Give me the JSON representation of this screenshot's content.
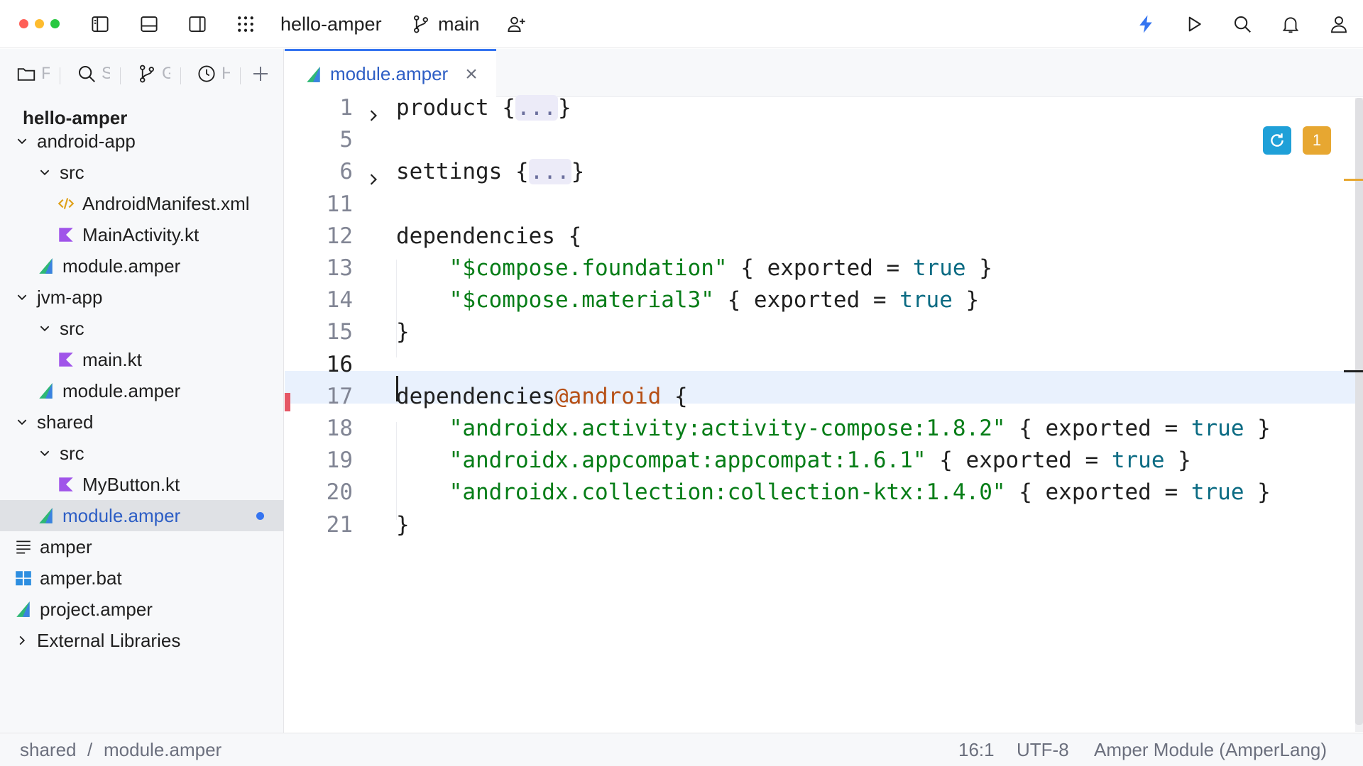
{
  "titlebar": {
    "project": "hello-amper",
    "branch": "main",
    "icons": [
      "sidebar-left-icon",
      "bottom-panel-icon",
      "sidebar-right-icon",
      "app-grid-icon",
      "branch-icon",
      "add-user-icon",
      "lightning-icon",
      "run-icon",
      "search-icon",
      "bell-icon",
      "profile-icon"
    ],
    "traffic_colors": [
      "#ff5f57",
      "#febc2e",
      "#28c840"
    ],
    "accent_color": "#3574f0"
  },
  "left_panel": {
    "tabs": [
      {
        "icon": "folder-icon",
        "label": "F"
      },
      {
        "icon": "search-icon",
        "label": "S"
      },
      {
        "icon": "git-icon",
        "label": "G"
      },
      {
        "icon": "clock-icon",
        "label": "H"
      }
    ],
    "root": "hello-amper",
    "items": [
      {
        "label": "android-app"
      },
      {
        "label": "src"
      },
      {
        "label": "AndroidManifest.xml"
      },
      {
        "label": "MainActivity.kt"
      },
      {
        "label": "module.amper"
      },
      {
        "label": "jvm-app"
      },
      {
        "label": "src"
      },
      {
        "label": "main.kt"
      },
      {
        "label": "module.amper"
      },
      {
        "label": "shared"
      },
      {
        "label": "src"
      },
      {
        "label": "MyButton.kt"
      },
      {
        "label": "module.amper"
      },
      {
        "label": "amper"
      },
      {
        "label": "amper.bat"
      },
      {
        "label": "project.amper"
      },
      {
        "label": "External Libraries"
      }
    ]
  },
  "editor": {
    "tab_label": "module.amper",
    "tab_close": "×",
    "warning_count": "1",
    "lines": [
      {
        "num": "1",
        "parts": [
          {
            "t": "product {"
          },
          {
            "t": "...",
            "c": "folded"
          },
          {
            "t": "}"
          }
        ]
      },
      {
        "num": "5",
        "parts": []
      },
      {
        "num": "6",
        "parts": [
          {
            "t": "settings {"
          },
          {
            "t": "...",
            "c": "folded"
          },
          {
            "t": "}"
          }
        ]
      },
      {
        "num": "11",
        "parts": []
      },
      {
        "num": "12",
        "parts": [
          {
            "t": "dependencies {"
          }
        ]
      },
      {
        "num": "13",
        "parts": [
          {
            "t": "    "
          },
          {
            "t": "\"$compose.foundation\"",
            "c": "str"
          },
          {
            "t": " { exported = "
          },
          {
            "t": "true",
            "c": "kw"
          },
          {
            "t": " }"
          }
        ]
      },
      {
        "num": "14",
        "parts": [
          {
            "t": "    "
          },
          {
            "t": "\"$compose.material3\"",
            "c": "str"
          },
          {
            "t": " { exported = "
          },
          {
            "t": "true",
            "c": "kw"
          },
          {
            "t": " }"
          }
        ]
      },
      {
        "num": "15",
        "parts": [
          {
            "t": "}"
          }
        ]
      },
      {
        "num": "16",
        "parts": []
      },
      {
        "num": "17",
        "parts": [
          {
            "t": "dependencies"
          },
          {
            "t": "@android",
            "c": "ann"
          },
          {
            "t": " {"
          }
        ]
      },
      {
        "num": "18",
        "parts": [
          {
            "t": "    "
          },
          {
            "t": "\"androidx.activity:activity-compose:1.8.2\"",
            "c": "str"
          },
          {
            "t": " { exported = "
          },
          {
            "t": "true",
            "c": "kw"
          },
          {
            "t": " }"
          }
        ]
      },
      {
        "num": "19",
        "parts": [
          {
            "t": "    "
          },
          {
            "t": "\"androidx.appcompat:appcompat:1.6.1\"",
            "c": "str"
          },
          {
            "t": " { exported = "
          },
          {
            "t": "true",
            "c": "kw"
          },
          {
            "t": " }"
          }
        ]
      },
      {
        "num": "20",
        "parts": [
          {
            "t": "    "
          },
          {
            "t": "\"androidx.collection:collection-ktx:1.4.0\"",
            "c": "str"
          },
          {
            "t": " { exported = "
          },
          {
            "t": "true",
            "c": "kw"
          },
          {
            "t": " }"
          }
        ]
      },
      {
        "num": "21",
        "parts": [
          {
            "t": "}"
          }
        ]
      }
    ]
  },
  "statusbar": {
    "breadcrumb_1": "shared",
    "separator": "/",
    "breadcrumb_2": "module.amper",
    "position": "16:1",
    "encoding": "UTF-8",
    "file_type": "Amper Module (AmperLang)"
  }
}
